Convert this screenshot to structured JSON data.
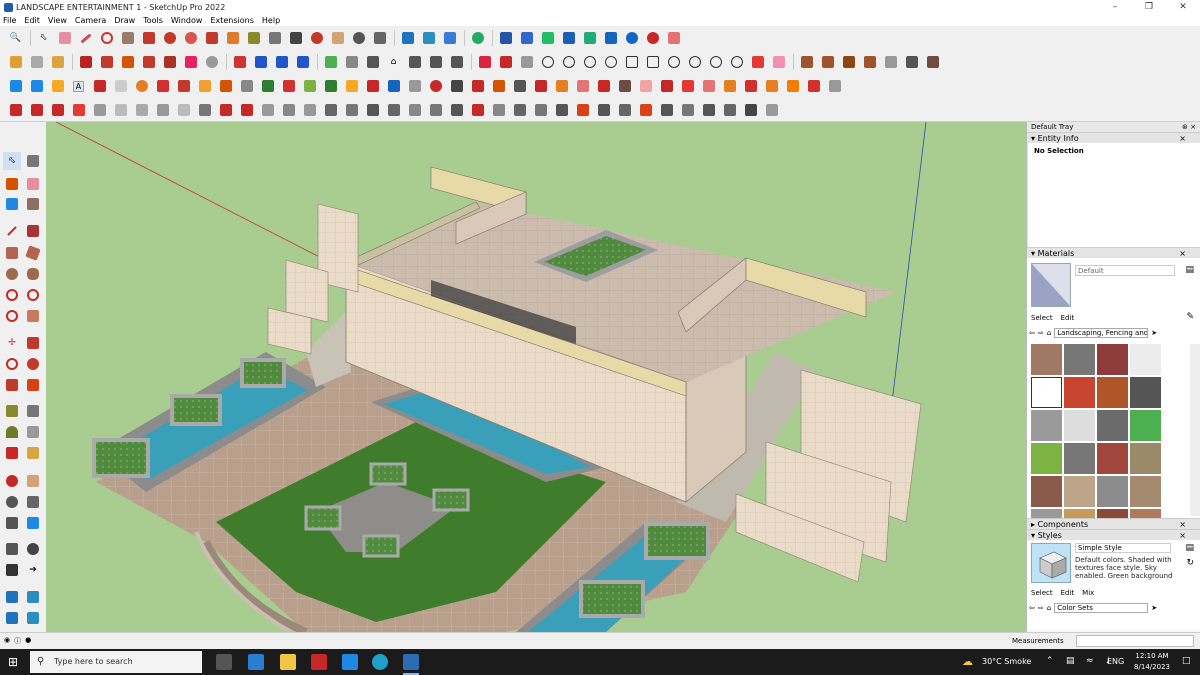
{
  "window": {
    "title": "LANDSCAPE ENTERTAINMENT 1 - SketchUp Pro 2022",
    "controls": [
      "–",
      "❐",
      "✕"
    ]
  },
  "menu": [
    "File",
    "Edit",
    "View",
    "Camera",
    "Draw",
    "Tools",
    "Window",
    "Extensions",
    "Help"
  ],
  "toolbar": {
    "tag_label": "A"
  },
  "colors": {
    "viewport_bg": "#a9cc91",
    "lawn": "#3f7d2d",
    "paving": "#b49a86",
    "water": "#3a9fb8",
    "wall": "#e3d4c4",
    "cap": "#c9c2a0"
  },
  "tray": {
    "title": "Default Tray",
    "entity_info": {
      "title": "Entity Info",
      "status": "No Selection"
    },
    "materials": {
      "title": "Materials",
      "current": "Default",
      "tabs": [
        "Select",
        "Edit"
      ],
      "library": "Landscaping, Fencing and \\"
    },
    "components": {
      "title": "Components"
    },
    "styles": {
      "title": "Styles",
      "name": "Simple Style",
      "description": "Default colors.  Shaded with textures face style.  Sky enabled.  Green background",
      "tabs": [
        "Select",
        "Edit",
        "Mix"
      ],
      "collection": "Color Sets"
    }
  },
  "statusbar": {
    "measurements_label": "Measurements"
  },
  "taskbar": {
    "search_placeholder": "Type here to search",
    "weather": "30°C  Smoke",
    "lang": "ENG",
    "time": "12:10 AM",
    "date": "8/14/2023"
  }
}
